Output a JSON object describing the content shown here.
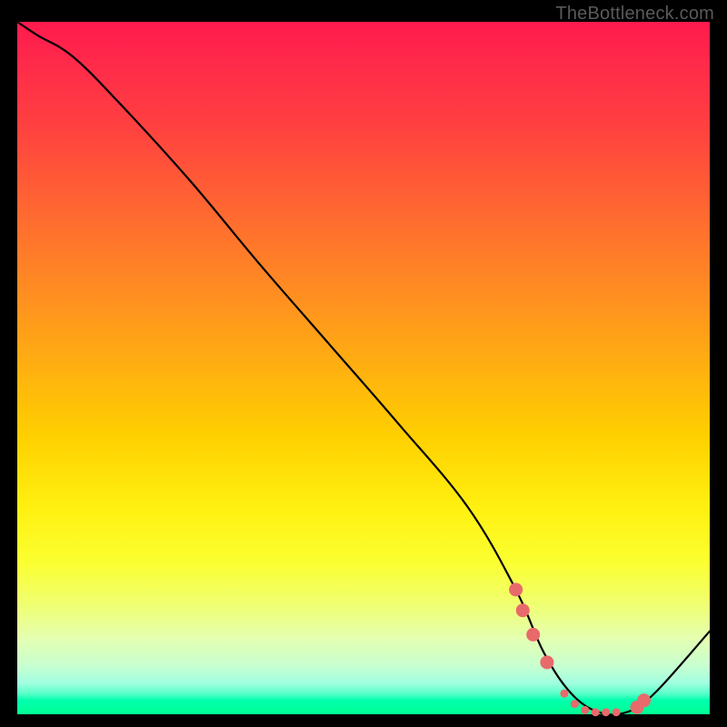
{
  "watermark": "TheBottleneck.com",
  "chart_data": {
    "type": "line",
    "title": "",
    "xlabel": "",
    "ylabel": "",
    "xlim": [
      0,
      100
    ],
    "ylim": [
      0,
      100
    ],
    "series": [
      {
        "name": "bottleneck-curve",
        "x": [
          0,
          3,
          8,
          15,
          25,
          35,
          45,
          55,
          65,
          72,
          76,
          80,
          84,
          88,
          92,
          100
        ],
        "values": [
          100,
          98,
          95,
          88,
          77,
          65,
          53.5,
          42,
          30,
          18,
          9,
          3,
          0.3,
          0.3,
          3,
          12
        ]
      }
    ],
    "markers": {
      "name": "highlight-range",
      "color": "#e86a6a",
      "points_x": [
        72.0,
        73.0,
        74.5,
        76.5,
        79.0,
        80.5,
        82.0,
        83.5,
        85.0,
        86.5,
        89.5,
        90.5
      ],
      "points_y": [
        18.0,
        15.0,
        11.5,
        7.5,
        3.0,
        1.5,
        0.6,
        0.3,
        0.3,
        0.3,
        1.0,
        2.0
      ],
      "small": [
        79.0,
        80.5,
        82.0,
        83.5,
        85.0,
        86.5
      ]
    }
  }
}
